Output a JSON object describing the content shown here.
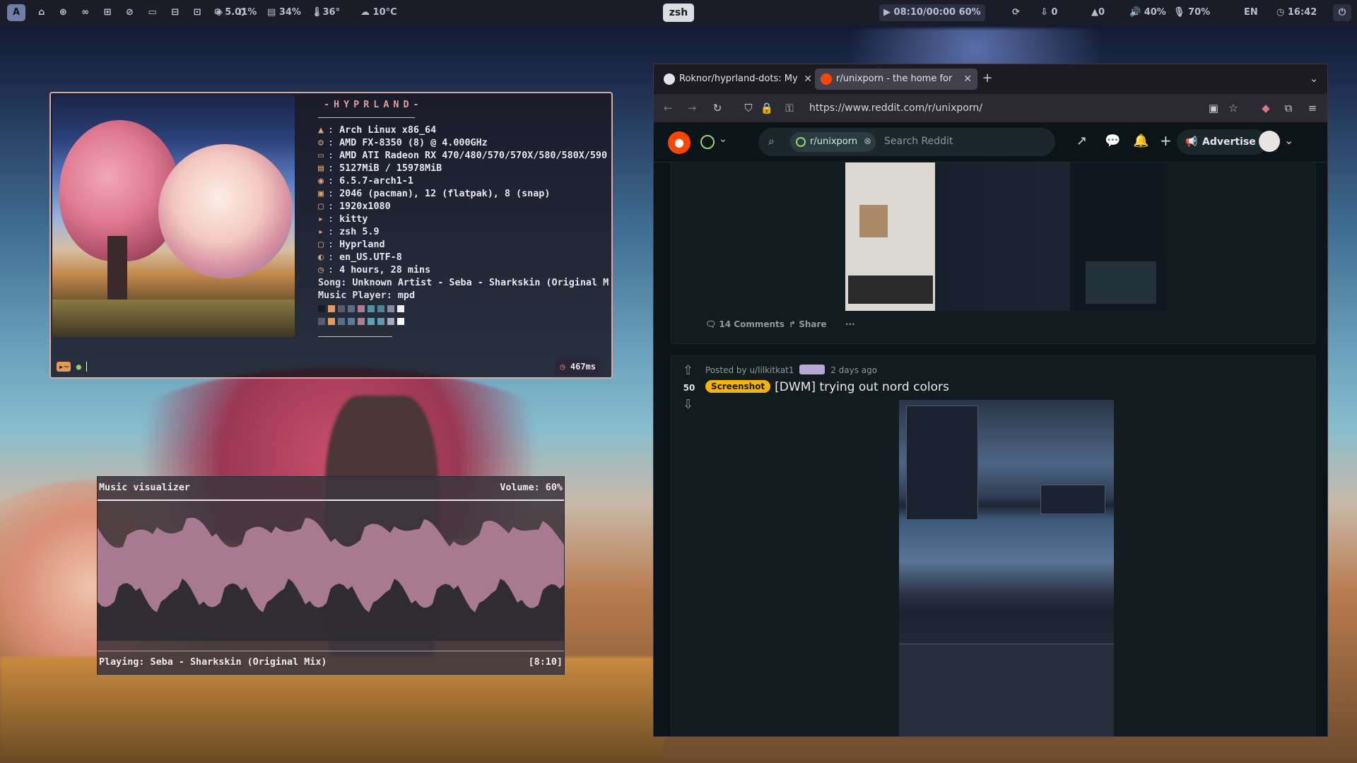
{
  "topbar": {
    "launcher_label": "A",
    "workspaces_icons": "⌂ ⊕ ∞ ⊞ ⊘ ▭ ⊟ ⊡ ◈ ♫",
    "cpu": "5.01%",
    "memory": "34%",
    "temp": "36°",
    "weather": "10°C",
    "center_label": "zsh",
    "media": "08:10/00:00 60%",
    "downloads": "0",
    "updates": "0",
    "volume": "40%",
    "mic": "70%",
    "lang": "EN",
    "clock": "16:42"
  },
  "fetch": {
    "title": "-HYPRLAND-",
    "separator": "—————————————————",
    "lines": [
      {
        "icon": "▲",
        "text": "Arch Linux x86_64"
      },
      {
        "icon": "⚙",
        "text": "AMD FX-8350 (8) @ 4.000GHz"
      },
      {
        "icon": "▭",
        "text": "AMD ATI Radeon RX 470/480/570/570X/580/580X/590"
      },
      {
        "icon": "▤",
        "text": "5127MiB / 15978MiB"
      },
      {
        "icon": "◉",
        "text": "6.5.7-arch1-1"
      },
      {
        "icon": "▣",
        "text": "2046 (pacman), 12 (flatpak), 8 (snap)"
      },
      {
        "icon": "▢",
        "text": "1920x1080"
      },
      {
        "icon": "▸",
        "text": "kitty"
      },
      {
        "icon": "▸",
        "text": "zsh 5.9"
      },
      {
        "icon": "▢",
        "text": "Hyprland"
      },
      {
        "icon": "◐",
        "text": "en_US.UTF-8"
      },
      {
        "icon": "◷",
        "text": "4 hours, 28 mins"
      }
    ],
    "song_label": "Song:",
    "song": "Unknown Artist - Seba - Sharkskin (Original M",
    "player_label": "Music Player:",
    "player": "mpd",
    "swatch_row1": [
      "#1a1924",
      "#e39b5b",
      "#5d5a6e",
      "#5b6d87",
      "#b07c8f",
      "#4c94a3",
      "#4e8593",
      "#8a8aa0",
      "#f0ecf2"
    ],
    "swatch_row2": [
      "#5d5a6e",
      "#e39b5b",
      "#5b6d87",
      "#5d7a98",
      "#b07c8f",
      "#5ba5b3",
      "#5e9bb3",
      "#a8a6b8",
      "#ffffff"
    ],
    "bottom_separator": "—————————————",
    "prompt_icon": "▸~",
    "elapsed": "467ms"
  },
  "visualizer": {
    "title": "Music visualizer",
    "volume": "Volume: 60%",
    "playing": "Playing: Seba - Sharkskin (Original Mix)",
    "time": "[8:10]"
  },
  "browser": {
    "tabs": [
      {
        "title": "Roknor/hyprland-dots: My",
        "active": false
      },
      {
        "title": "r/unixporn - the home for",
        "active": true
      }
    ],
    "new_tab": "+",
    "url": "https://www.reddit.com/r/unixporn/",
    "reddit": {
      "subreddit_chip": "r/unixporn",
      "search_placeholder": "Search Reddit",
      "advertise": "Advertise",
      "post1": {
        "comments": "14 Comments",
        "share": "Share",
        "more": "···"
      },
      "post2": {
        "meta": "Posted by u/lilkitkat1",
        "time": "2 days ago",
        "votes": "50",
        "flair": "Screenshot",
        "title": "[DWM] trying out nord colors"
      }
    }
  },
  "colors": {
    "accent_pink": "#d8a8a4",
    "reddit_orange": "#ff4500",
    "flair_yellow": "#f4b400",
    "viz_wave": "#a87a92"
  }
}
